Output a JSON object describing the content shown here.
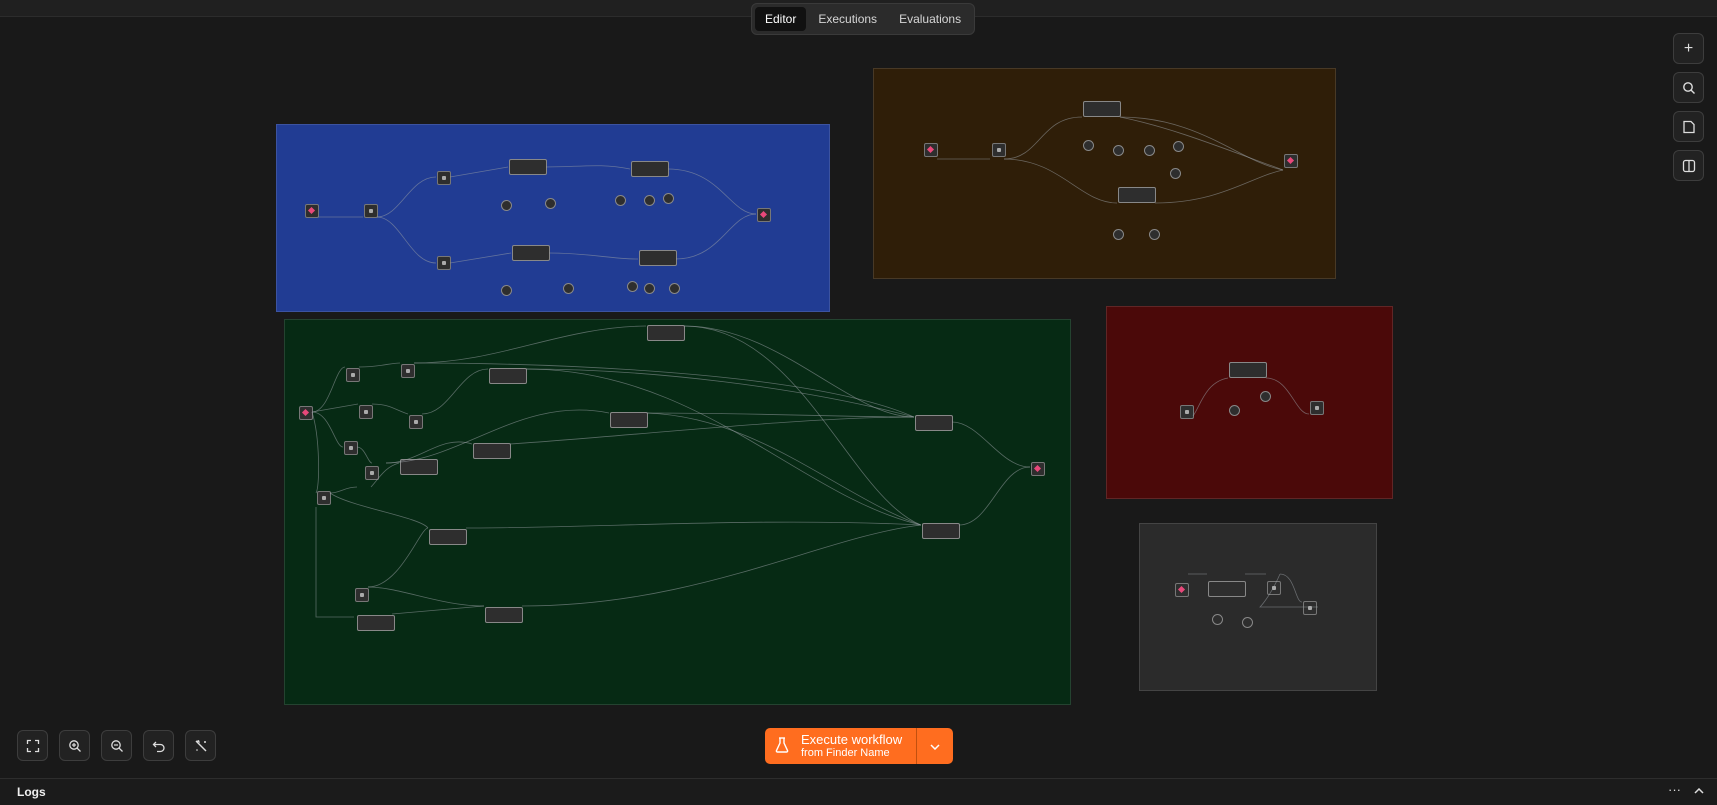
{
  "tabs": [
    {
      "label": "Editor",
      "active": true
    },
    {
      "label": "Executions",
      "active": false
    },
    {
      "label": "Evaluations",
      "active": false
    }
  ],
  "right_toolbar": [
    {
      "icon": "plus-icon"
    },
    {
      "icon": "search-icon"
    },
    {
      "icon": "sticky-note-icon"
    },
    {
      "icon": "panel-toggle-icon"
    }
  ],
  "bottom_toolbar": [
    {
      "icon": "fit-view-icon"
    },
    {
      "icon": "zoom-in-icon"
    },
    {
      "icon": "zoom-out-icon"
    },
    {
      "icon": "undo-icon"
    },
    {
      "icon": "tidy-up-icon"
    }
  ],
  "execute": {
    "label": "Execute workflow",
    "sublabel": "from Finder Name",
    "color": "#ff6d1f"
  },
  "logs": {
    "title": "Logs"
  },
  "groups": [
    {
      "id": "blue",
      "color": "#213c93"
    },
    {
      "id": "orange",
      "color": "#2f1e08"
    },
    {
      "id": "green",
      "color": "#062a14"
    },
    {
      "id": "red",
      "color": "#4b0909"
    },
    {
      "id": "gray",
      "color": "#2b2b2b"
    }
  ]
}
